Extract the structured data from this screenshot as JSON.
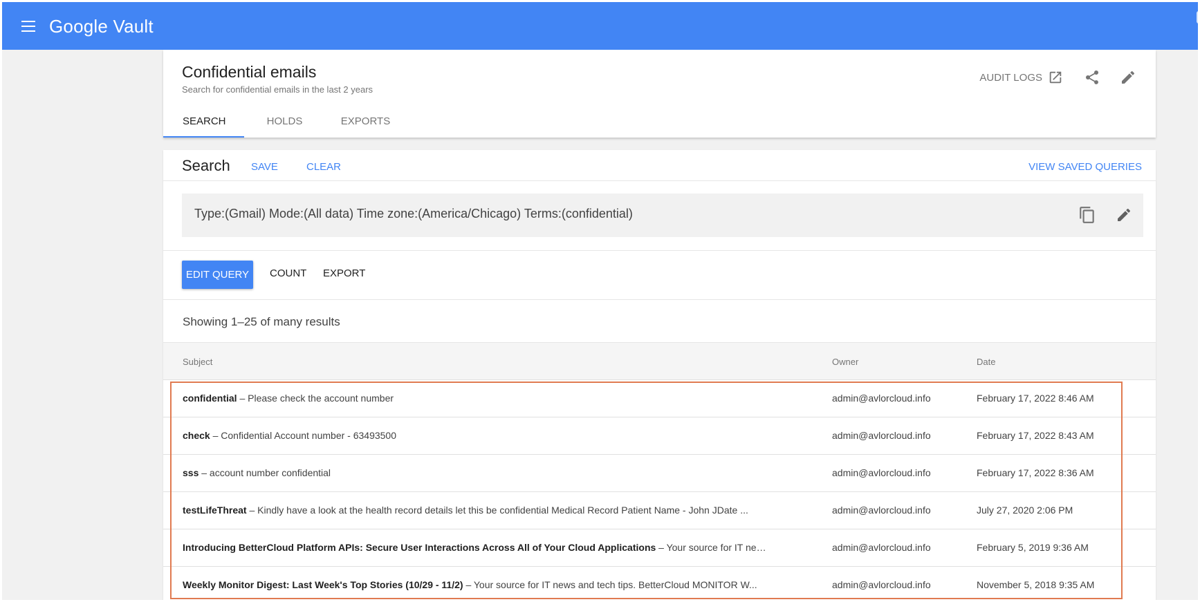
{
  "app": {
    "brand": "Google Vault",
    "menu_icon": "hamburger-menu-icon"
  },
  "matter": {
    "title": "Confidential emails",
    "description": "Search for confidential emails in the last 2 years",
    "audit_logs_label": "AUDIT LOGS",
    "tabs": [
      {
        "label": "SEARCH",
        "active": true
      },
      {
        "label": "HOLDS",
        "active": false
      },
      {
        "label": "EXPORTS",
        "active": false
      }
    ]
  },
  "search": {
    "title": "Search",
    "save_label": "SAVE",
    "clear_label": "CLEAR",
    "view_saved_label": "VIEW SAVED QUERIES",
    "query": "Type:(Gmail) Mode:(All data) Time zone:(America/Chicago) Terms:(confidential)",
    "edit_query_label": "EDIT QUERY",
    "count_label": "COUNT",
    "export_label": "EXPORT"
  },
  "results": {
    "summary": "Showing 1–25 of many results",
    "columns": {
      "subject": "Subject",
      "owner": "Owner",
      "date": "Date"
    },
    "rows": [
      {
        "subject": "confidential",
        "snippet": " – Please check the account number",
        "owner": "admin@avlorcloud.info",
        "date": "February 17, 2022 8:46 AM"
      },
      {
        "subject": "check",
        "snippet": " – Confidential Account number - 63493500",
        "owner": "admin@avlorcloud.info",
        "date": "February 17, 2022 8:43 AM"
      },
      {
        "subject": "sss",
        "snippet": " – account number confidential",
        "owner": "admin@avlorcloud.info",
        "date": "February 17, 2022 8:36 AM"
      },
      {
        "subject": "testLifeThreat",
        "snippet": " – Kindly have a look at the health record details let this be confidential Medical Record Patient Name - John JDate ...",
        "owner": "admin@avlorcloud.info",
        "date": "July 27, 2020 2:06 PM"
      },
      {
        "subject": "Introducing BetterCloud Platform APIs: Secure User Interactions Across All of Your Cloud Applications",
        "snippet": " – Your source for IT new...",
        "owner": "admin@avlorcloud.info",
        "date": "February 5, 2019 9:36 AM"
      },
      {
        "subject": "Weekly Monitor Digest: Last Week's Top Stories (10/29 - 11/2)",
        "snippet": " – Your source for IT news and tech tips. BetterCloud MONITOR W...",
        "owner": "admin@avlorcloud.info",
        "date": "November 5, 2018 9:35 AM"
      }
    ]
  },
  "colors": {
    "brand_blue": "#4285f4",
    "highlight": "#e07a50"
  }
}
